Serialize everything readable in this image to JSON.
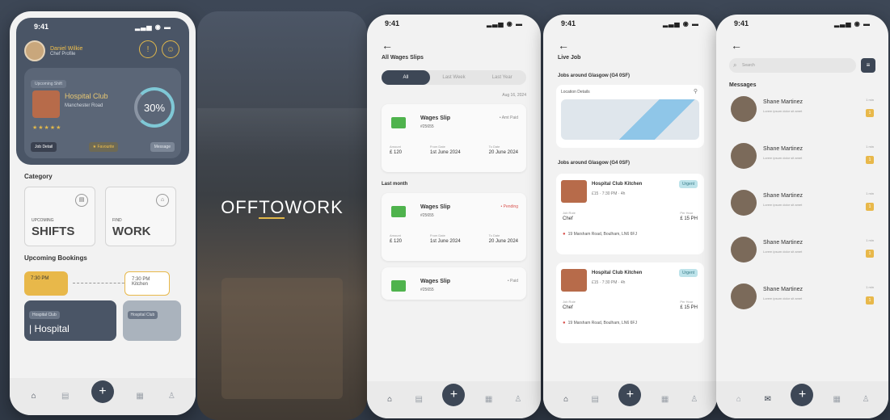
{
  "status_time": "9:41",
  "status_icons": "▂▃▅ ◉ ▬",
  "home": {
    "user_name": "Daniel Wilkie",
    "user_role": "Chef Profile",
    "bell_icon": "!",
    "user_icon": "☺",
    "tag": "Upcoming Shift",
    "job_title": "Hospital Club",
    "job_subtitle": "Manchester Road",
    "rating": "★★★★★",
    "progress": "30%",
    "progress_value": 0.3,
    "chip_a": "Job Detail",
    "chip_b": "★ Favourite",
    "chip_c": "Message",
    "category_label": "Category",
    "categories": [
      {
        "small": "UPCOMING",
        "big": "SHIFTS",
        "icon": "▤"
      },
      {
        "small": "FIND",
        "big": "WORK",
        "icon": "⌂"
      }
    ],
    "bookings_label": "Upcoming Bookings",
    "time_active": "7:30 PM",
    "time_next": "7:30 PM",
    "time_next_sub": "Kitchen",
    "booking_tag": "Hospital Club",
    "booking_title": "| Hospital",
    "booking2_tag": "Hospital Club"
  },
  "brand": {
    "left": "OFF",
    "mid": "TO",
    "right": "WORK"
  },
  "wages": {
    "title": "All Wages Slips",
    "tabs": [
      "All",
      "Last Week",
      "Last Year"
    ],
    "date": "Aug 16, 2024",
    "month_label": "Last month",
    "slips": [
      {
        "title": "Wages Slip",
        "id": "#25655",
        "status": "• Amt Paid",
        "status_red": false,
        "amount_k": "Amount",
        "amount": "£ 120",
        "from_k": "From Date",
        "from": "1st June 2024",
        "to_k": "To Date",
        "to": "20 June 2024"
      },
      {
        "title": "Wages Slip",
        "id": "#25655",
        "status": "• Pending",
        "status_red": true,
        "amount_k": "Amount",
        "amount": "£ 120",
        "from_k": "From Date",
        "from": "1st June 2024",
        "to_k": "To Date",
        "to": "20 June 2024"
      },
      {
        "title": "Wages Slip",
        "id": "#25655",
        "status": "• Paid",
        "status_red": false
      }
    ]
  },
  "jobs": {
    "title": "Live Job",
    "near_a": "Jobs around Glasgow (G4 0SF)",
    "location_label": "Location Details",
    "near_b": "Jobs around Glasgow (G4 0SF)",
    "cards": [
      {
        "title": "Hospital Club Kitchen",
        "badge": "Urgent",
        "rate": "£15 · 7:30 PM · 4h",
        "k1": "Job Role",
        "v1": "Chef",
        "k2": "Per Hour",
        "v2": "£ 15 PH",
        "addr": "19 Marsham Road, Boulham, LN6 6FJ"
      },
      {
        "title": "Hospital Club Kitchen",
        "badge": "Urgent",
        "rate": "£15 · 7:30 PM · 4h",
        "k1": "Job Role",
        "v1": "Chef",
        "k2": "Per Hour",
        "v2": "£ 15 PH",
        "addr": "19 Marsham Road, Boulham, LN6 6FJ"
      }
    ]
  },
  "messages": {
    "search_placeholder": "Search",
    "title": "Messages",
    "items": [
      {
        "name": "Shane Martinez",
        "text": "Lorem ipsum dolor sit amet",
        "time": "1 min",
        "unread": "1"
      },
      {
        "name": "Shane Martinez",
        "text": "Lorem ipsum dolor sit amet",
        "time": "1 min",
        "unread": "1"
      },
      {
        "name": "Shane Martinez",
        "text": "Lorem ipsum dolor sit amet",
        "time": "1 min",
        "unread": "1"
      },
      {
        "name": "Shane Martinez",
        "text": "Lorem ipsum dolor sit amet",
        "time": "1 min",
        "unread": "1"
      },
      {
        "name": "Shane Martinez",
        "text": "Lorem ipsum dolor sit amet",
        "time": "1 min",
        "unread": "1"
      }
    ]
  },
  "tabbar": {
    "home": "⌂",
    "list": "▤",
    "fab": "+",
    "grid": "▦",
    "user": "♙"
  },
  "colors": {
    "primary": "#3d4756",
    "accent": "#e8b84a",
    "success": "#4fb34d",
    "danger": "#d9534f"
  }
}
